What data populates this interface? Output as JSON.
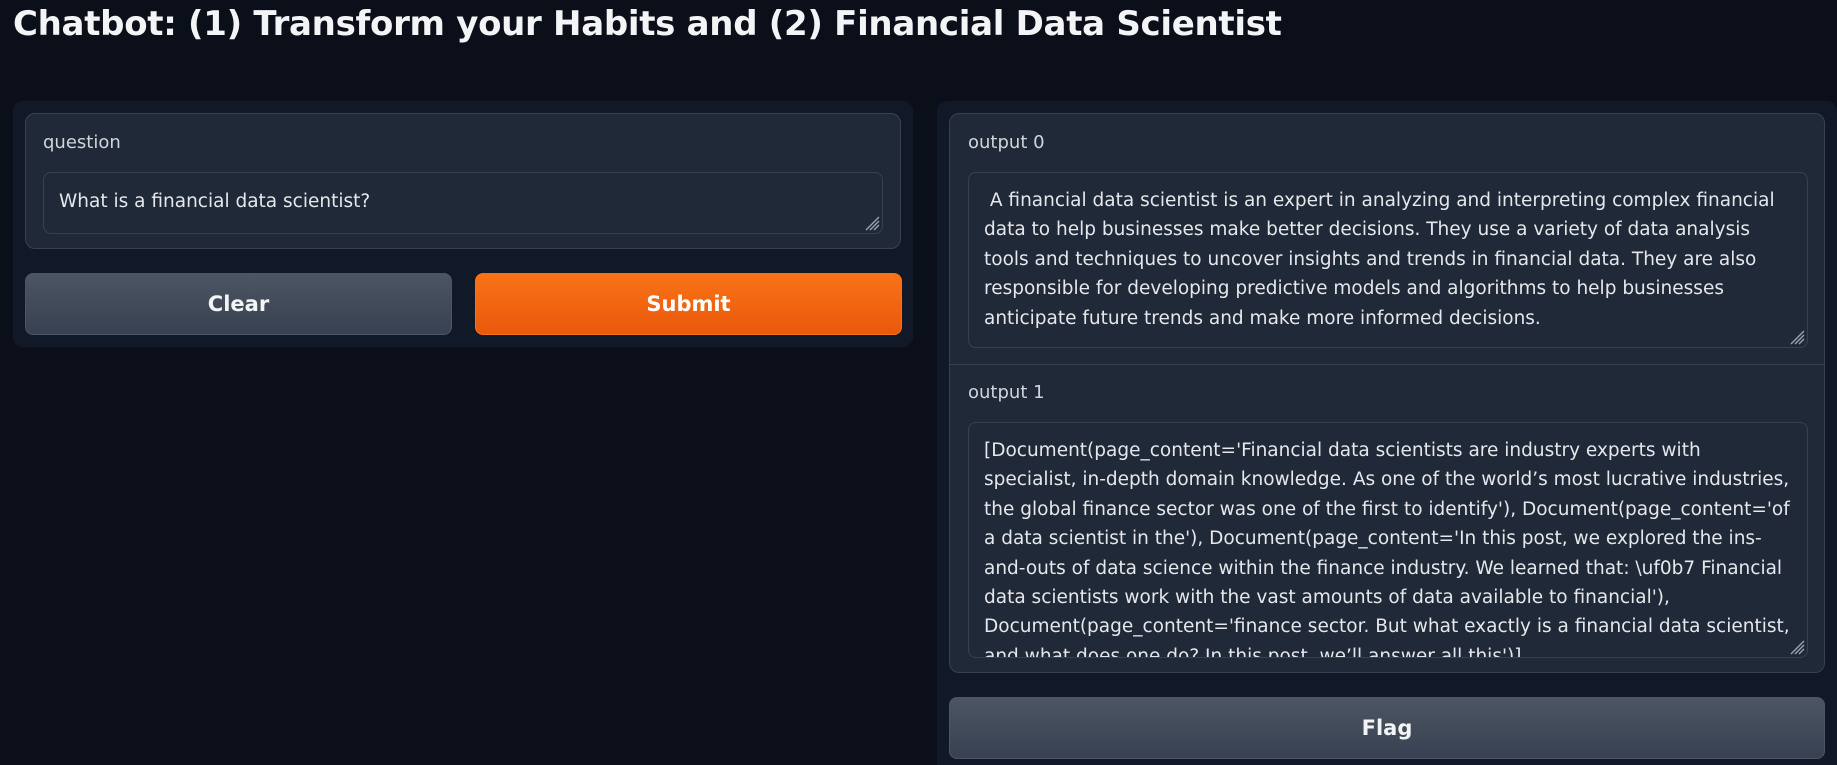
{
  "app": {
    "title": "Chatbot: (1) Transform your Habits and (2) Financial Data Scientist"
  },
  "input": {
    "label": "question",
    "value": "What is a financial data scientist?"
  },
  "buttons": {
    "clear": "Clear",
    "submit": "Submit",
    "flag": "Flag"
  },
  "outputs": [
    {
      "label": "output 0",
      "value": " A financial data scientist is an expert in analyzing and interpreting complex financial data to help businesses make better decisions. They use a variety of data analysis tools and techniques to uncover insights and trends in financial data. They are also responsible for developing predictive models and algorithms to help businesses anticipate future trends and make more informed decisions."
    },
    {
      "label": "output 1",
      "value": "[Document(page_content='Financial data scientists are industry experts with specialist, in-depth domain knowledge. As one of the world’s most lucrative industries, the global finance sector was one of the first to identify'), Document(page_content='of a data scientist in the'), Document(page_content='In this post, we explored the ins-and-outs of data science within the finance industry. We learned that: \\uf0b7 Financial data scientists work with the vast amounts of data available to financial'), Document(page_content='finance sector. But what exactly is a financial data scientist, and what does one do? In this post, we’ll answer all this')]"
    }
  ],
  "colors": {
    "background": "#0b0f19",
    "panel": "#111827",
    "block": "#1f2937",
    "border": "#374151",
    "primary": "#f97316",
    "secondary": "#4b5563"
  }
}
